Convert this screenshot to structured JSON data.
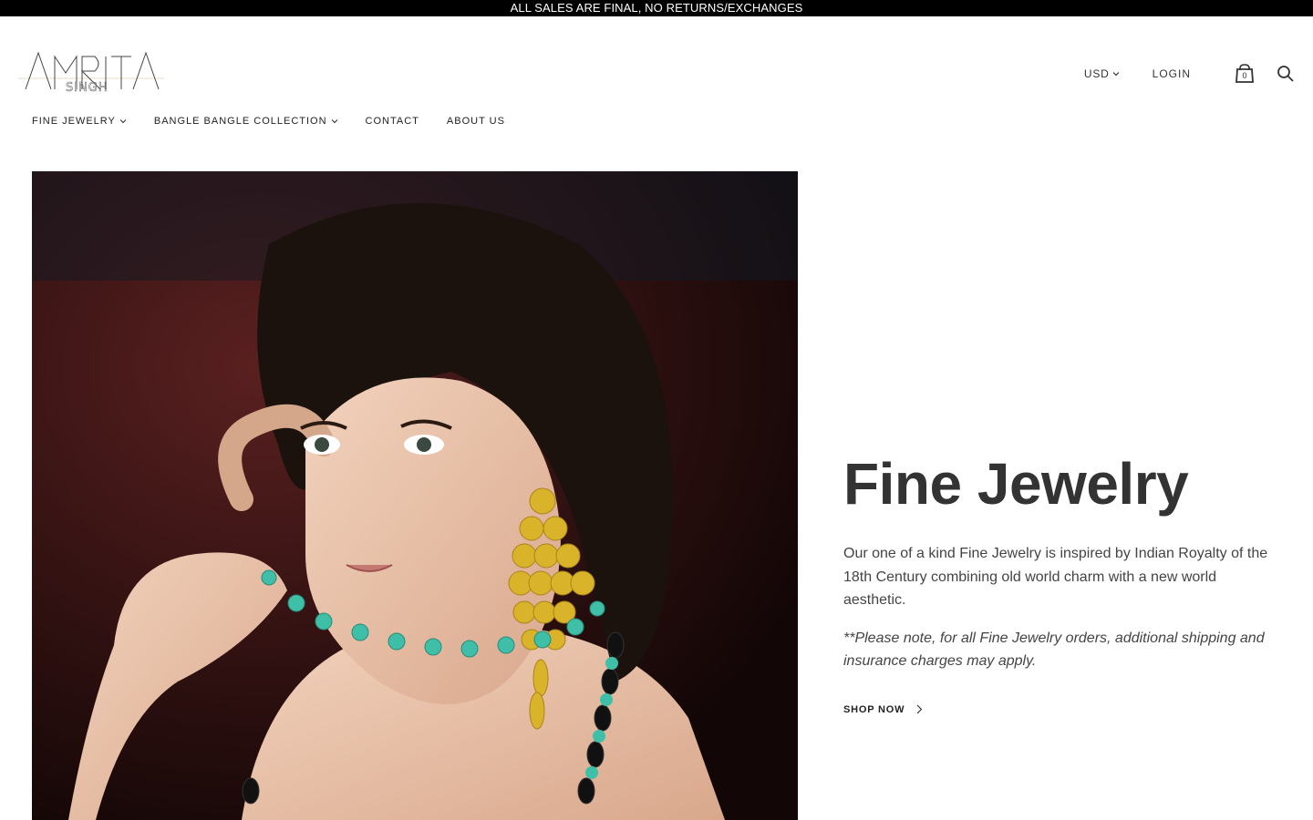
{
  "announcement": "ALL SALES ARE FINAL, NO RETURNS/EXCHANGES",
  "logo": {
    "line1": "AMRITA",
    "line2": "SINGH"
  },
  "utils": {
    "currency": "USD",
    "login": "LOGIN",
    "cart_count": "0",
    "icons": {
      "currency_chevron": "chevron-down-icon",
      "cart": "shopping-bag-icon",
      "search": "search-icon"
    }
  },
  "nav": {
    "items": [
      {
        "label": "FINE JEWELRY",
        "has_dropdown": true
      },
      {
        "label": "BANGLE BANGLE COLLECTION",
        "has_dropdown": true
      },
      {
        "label": "CONTACT",
        "has_dropdown": false
      },
      {
        "label": "ABOUT US",
        "has_dropdown": false
      }
    ]
  },
  "feature": {
    "title": "Fine Jewelry",
    "description": "Our one of a kind Fine Jewelry is inspired by Indian Royalty of the 18th Century combining old world charm with a new world aesthetic.",
    "note": "**Please note, for all Fine Jewelry orders, additional shipping and insurance charges may apply.",
    "cta": "SHOP NOW",
    "cta_icon": "chevron-right-icon"
  },
  "colors": {
    "announcement_bg": "#000000",
    "text": "#333333",
    "accent_gold": "#d9b42a",
    "turquoise": "#3fbfa7"
  }
}
